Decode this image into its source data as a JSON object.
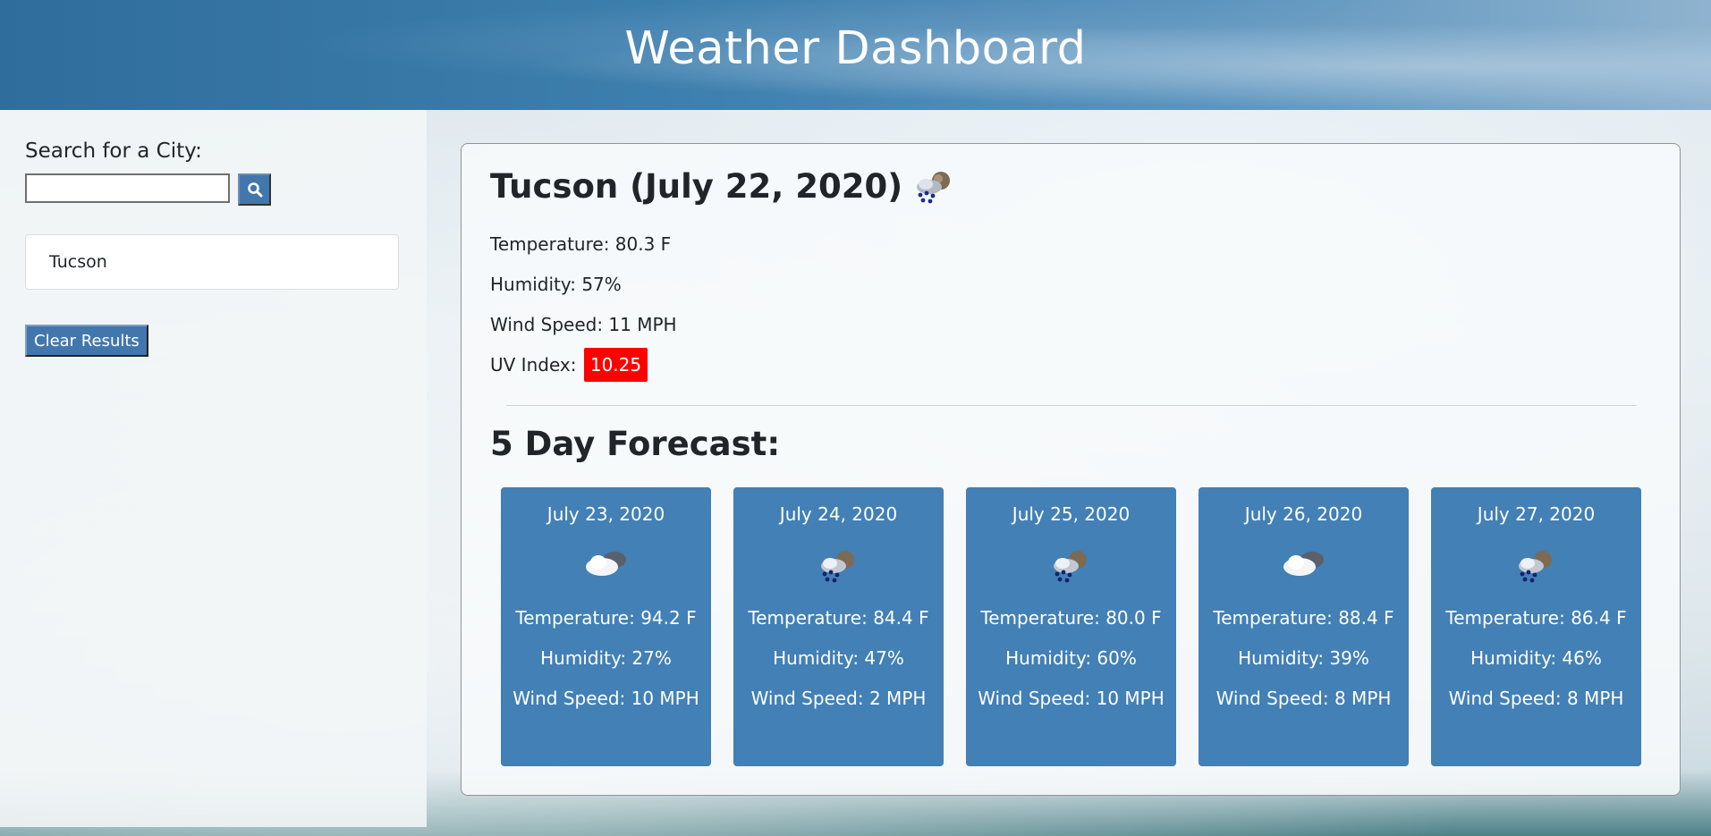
{
  "header": {
    "title": "Weather Dashboard"
  },
  "sidebar": {
    "search_label": "Search for a City:",
    "search_value": "",
    "search_button_icon": "search-icon",
    "history": [
      "Tucson"
    ],
    "clear_label": "Clear Results"
  },
  "current": {
    "title": "Tucson (July 22, 2020)",
    "icon": "rain-cloud-icon",
    "temperature": "Temperature: 80.3 F",
    "humidity": "Humidity: 57%",
    "wind": "Wind Speed: 11 MPH",
    "uv_label": "UV Index:",
    "uv_value": "10.25",
    "uv_color": "#ff0000"
  },
  "forecast": {
    "title": "5 Day Forecast:",
    "days": [
      {
        "date": "July 23, 2020",
        "icon": "cloudy-icon",
        "temp": "Temperature: 94.2 F",
        "humidity": "Humidity: 27%",
        "wind": "Wind Speed: 10 MPH"
      },
      {
        "date": "July 24, 2020",
        "icon": "rain-cloud-icon",
        "temp": "Temperature: 84.4 F",
        "humidity": "Humidity: 47%",
        "wind": "Wind Speed: 2 MPH"
      },
      {
        "date": "July 25, 2020",
        "icon": "rain-cloud-icon",
        "temp": "Temperature: 80.0 F",
        "humidity": "Humidity: 60%",
        "wind": "Wind Speed: 10 MPH"
      },
      {
        "date": "July 26, 2020",
        "icon": "cloudy-icon",
        "temp": "Temperature: 88.4 F",
        "humidity": "Humidity: 39%",
        "wind": "Wind Speed: 8 MPH"
      },
      {
        "date": "July 27, 2020",
        "icon": "rain-cloud-icon",
        "temp": "Temperature: 86.4 F",
        "humidity": "Humidity: 46%",
        "wind": "Wind Speed: 8 MPH"
      }
    ]
  },
  "colors": {
    "accent": "#4277ad",
    "card": "#4280b5",
    "uv_high": "#ff0000"
  }
}
